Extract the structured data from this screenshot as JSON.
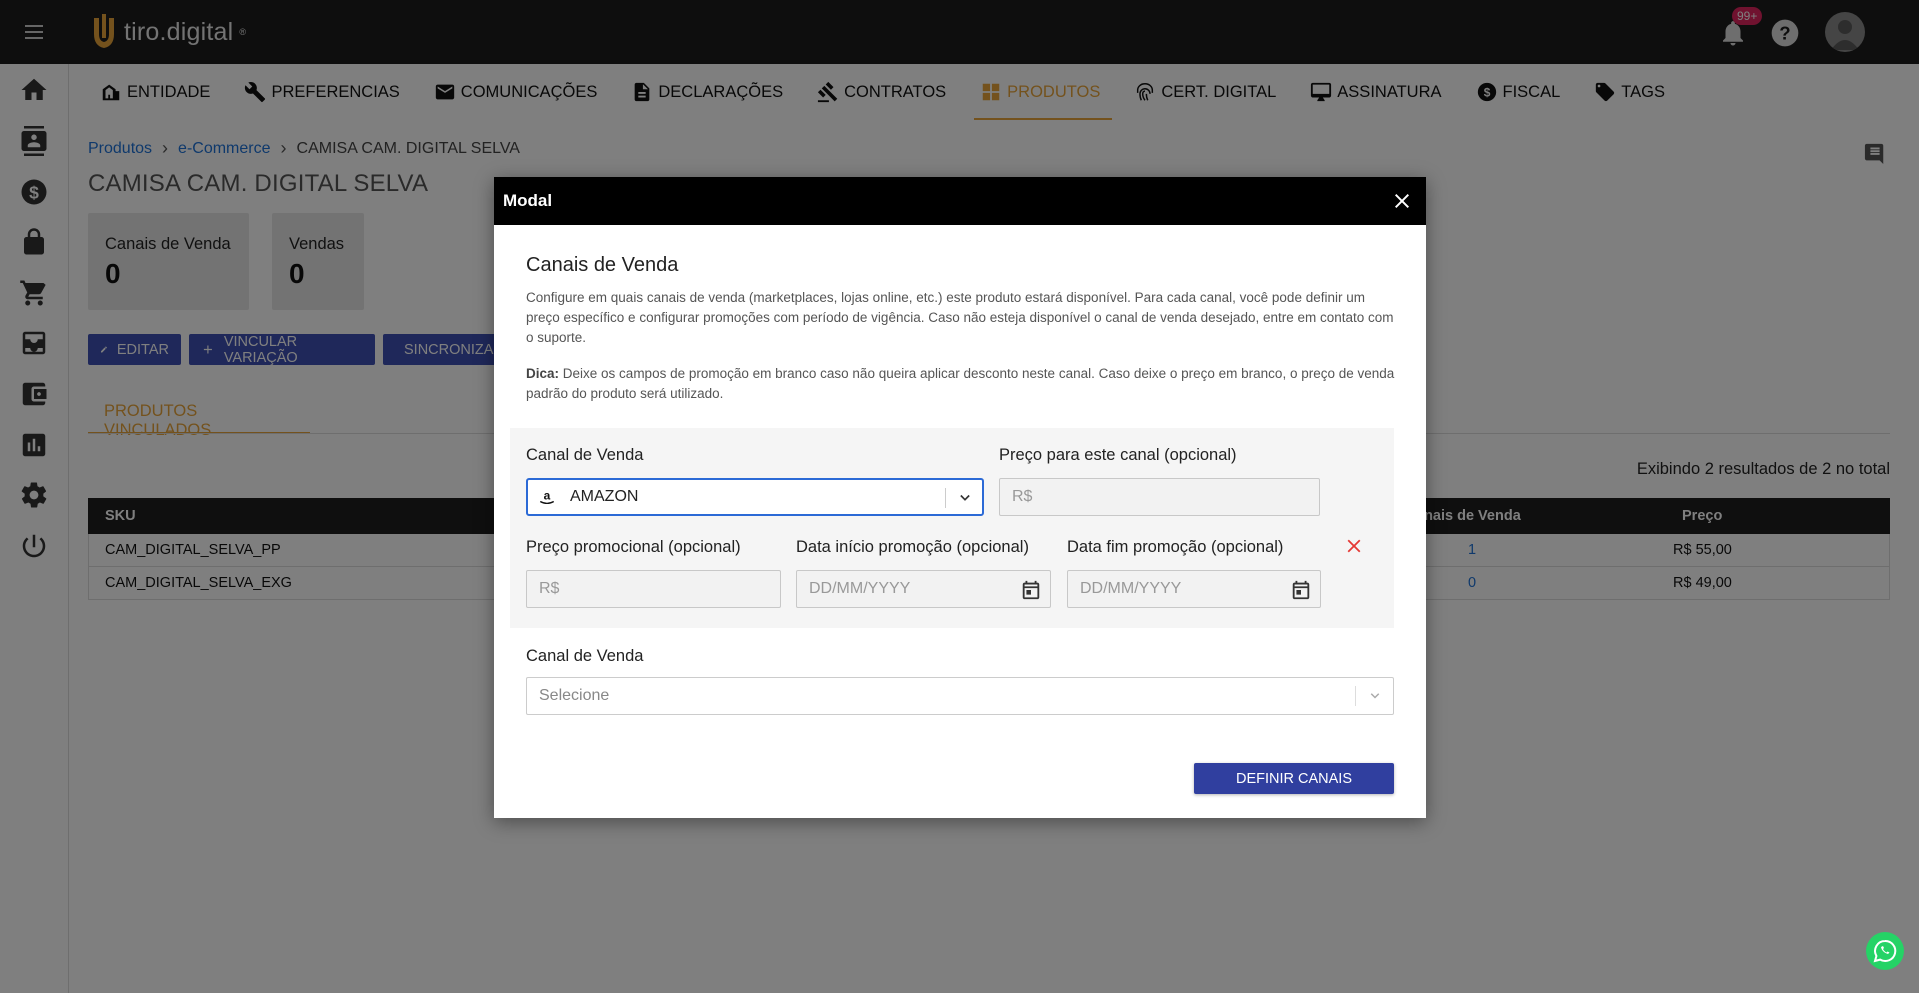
{
  "app": {
    "logo_text": "tiro.digital",
    "logo_reg": "®"
  },
  "topbar": {
    "notifications_badge": "99+"
  },
  "nav_tabs": [
    {
      "label": "ENTIDADE",
      "icon": "building-icon"
    },
    {
      "label": "PREFERENCIAS",
      "icon": "wrench-icon"
    },
    {
      "label": "COMUNICAÇÕES",
      "icon": "mail-icon"
    },
    {
      "label": "DECLARAÇÕES",
      "icon": "document-icon"
    },
    {
      "label": "CONTRATOS",
      "icon": "gavel-icon"
    },
    {
      "label": "PRODUTOS",
      "icon": "grid-icon",
      "active": true
    },
    {
      "label": "CERT. DIGITAL",
      "icon": "fingerprint-icon"
    },
    {
      "label": "ASSINATURA",
      "icon": "monitor-icon"
    },
    {
      "label": "FISCAL",
      "icon": "dollar-circle-icon"
    },
    {
      "label": "TAGS",
      "icon": "tag-icon"
    }
  ],
  "breadcrumb": {
    "items": [
      "Produtos",
      "e-Commerce"
    ],
    "current": "CAMISA CAM. DIGITAL SELVA",
    "separator": "›"
  },
  "page_title": "CAMISA CAM. DIGITAL SELVA",
  "stats": [
    {
      "label": "Canais de Venda",
      "value": "0"
    },
    {
      "label": "Vendas",
      "value": "0"
    }
  ],
  "actions": {
    "edit": "EDITAR",
    "link_variation": "VINCULAR VARIAÇÃO",
    "sync": "SINCRONIZA"
  },
  "subtab": "PRODUTOS VINCULADOS",
  "results_text": "Exibindo 2 resultados de 2 no total",
  "table": {
    "headers": {
      "sku": "SKU",
      "channels": "anais de Venda",
      "price": "Preço"
    },
    "rows": [
      {
        "sku": "CAM_DIGITAL_SELVA_PP",
        "channels": "1",
        "price": "R$ 55,00"
      },
      {
        "sku": "CAM_DIGITAL_SELVA_EXG",
        "channels": "0",
        "price": "R$ 49,00"
      }
    ]
  },
  "modal": {
    "title": "Modal",
    "heading": "Canais de Venda",
    "description": "Configure em quais canais de venda (marketplaces, lojas online, etc.) este produto estará disponível. Para cada canal, você pode definir um preço específico e configurar promoções com período de vigência. Caso não esteja disponível o canal de venda desejado, entre em contato com o suporte.",
    "tip_label": "Dica:",
    "tip_text": "Deixe os campos de promoção em branco caso não queira aplicar desconto neste canal. Caso deixe o preço em branco, o preço de venda padrão do produto será utilizado.",
    "channel_label": "Canal de Venda",
    "channel_value": "AMAZON",
    "price_label": "Preço para este canal (opcional)",
    "price_placeholder": "R$",
    "promo_price_label": "Preço promocional (opcional)",
    "promo_price_placeholder": "R$",
    "promo_start_label": "Data início promoção (opcional)",
    "promo_start_placeholder": "DD/MM/YYYY",
    "promo_end_label": "Data fim promoção (opcional)",
    "promo_end_placeholder": "DD/MM/YYYY",
    "new_channel_label": "Canal de Venda",
    "new_channel_placeholder": "Selecione",
    "submit": "DEFINIR CANAIS"
  },
  "colors": {
    "accent": "#e8a53a",
    "primary": "#3f51b5",
    "link": "#1e73d8",
    "danger": "#e53935",
    "focus": "#2c6ad6"
  }
}
